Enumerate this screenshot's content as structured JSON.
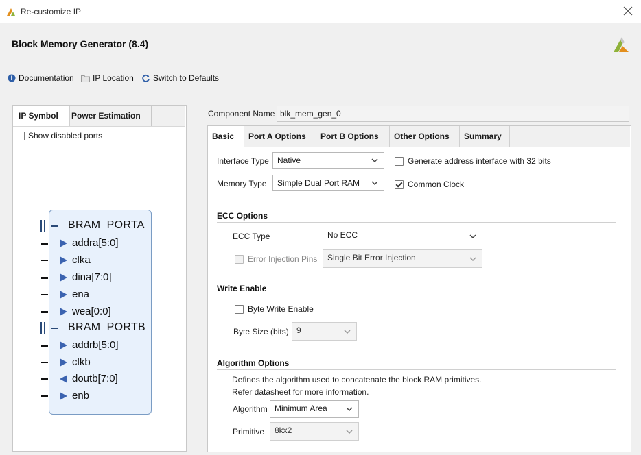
{
  "window": {
    "title": "Re-customize IP"
  },
  "header": {
    "title": "Block Memory Generator (8.4)"
  },
  "toolbar": {
    "documentation": "Documentation",
    "ip_location": "IP Location",
    "switch_defaults": "Switch to Defaults"
  },
  "left": {
    "tabs": [
      "IP Symbol",
      "Power Estimation"
    ],
    "show_disabled_ports": "Show disabled ports",
    "symbol": {
      "port_a": "BRAM_PORTA",
      "port_b": "BRAM_PORTB",
      "pins": [
        "addra[5:0]",
        "clka",
        "dina[7:0]",
        "ena",
        "wea[0:0]",
        "addrb[5:0]",
        "clkb",
        "doutb[7:0]",
        "enb"
      ]
    }
  },
  "component": {
    "label": "Component Name",
    "value": "blk_mem_gen_0"
  },
  "tabs": [
    "Basic",
    "Port A Options",
    "Port B Options",
    "Other Options",
    "Summary"
  ],
  "basic": {
    "interface_type_label": "Interface Type",
    "interface_type_value": "Native",
    "gen_addr_label": "Generate address interface with 32 bits",
    "memory_type_label": "Memory Type",
    "memory_type_value": "Simple Dual Port RAM",
    "common_clock_label": "Common Clock",
    "ecc_section": "ECC Options",
    "ecc_type_label": "ECC Type",
    "ecc_type_value": "No ECC",
    "error_injection_label": "Error Injection Pins",
    "error_injection_value": "Single Bit Error Injection",
    "write_enable_section": "Write Enable",
    "byte_write_label": "Byte Write Enable",
    "byte_size_label": "Byte Size (bits)",
    "byte_size_value": "9",
    "algo_section": "Algorithm Options",
    "algo_desc1": "Defines the algorithm used to concatenate the block RAM primitives.",
    "algo_desc2": "Refer datasheet for more information.",
    "algorithm_label": "Algorithm",
    "algorithm_value": "Minimum Area",
    "primitive_label": "Primitive",
    "primitive_value": "8kx2"
  },
  "colors": {
    "accent_blue": "#2f5fa8",
    "xilinx_orange": "#e38f1d",
    "xilinx_green": "#8fb23a"
  }
}
